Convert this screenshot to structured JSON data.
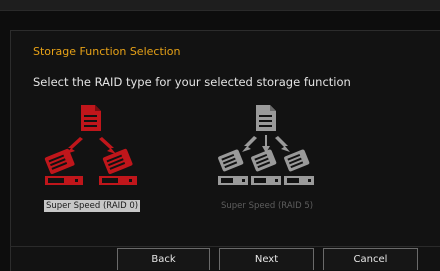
{
  "dialog": {
    "title": "Storage Function Selection",
    "subtitle": "Select the RAID type for your selected storage function"
  },
  "options": [
    {
      "label": "Super Speed (RAID 0)",
      "selected": true,
      "icon": "raid0-diagram-icon",
      "color": "#c0161b"
    },
    {
      "label": "Super Speed (RAID 5)",
      "selected": false,
      "icon": "raid5-diagram-icon",
      "color": "#9a9a9a"
    }
  ],
  "buttons": {
    "back": "Back",
    "next": "Next",
    "cancel": "Cancel"
  },
  "colors": {
    "accent": "#e6a117",
    "selected_red": "#c0161b",
    "disabled_gray": "#9a9a9a"
  }
}
